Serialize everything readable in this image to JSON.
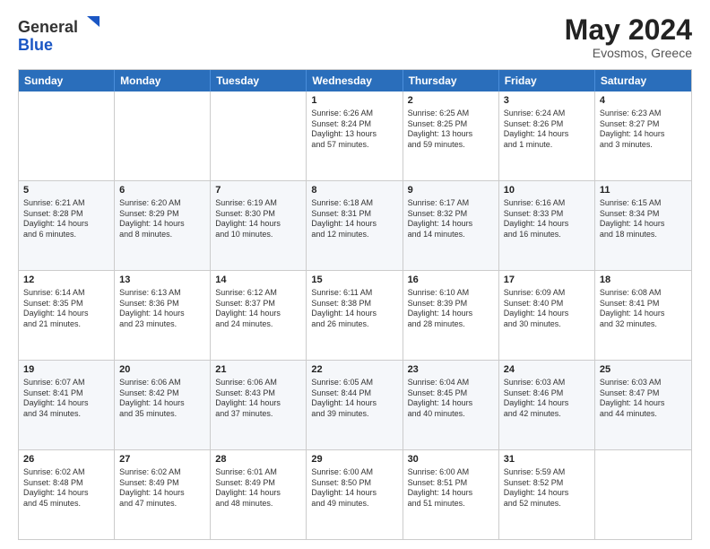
{
  "header": {
    "logo_line1": "General",
    "logo_line2": "Blue",
    "month": "May 2024",
    "location": "Evosmos, Greece"
  },
  "days": [
    "Sunday",
    "Monday",
    "Tuesday",
    "Wednesday",
    "Thursday",
    "Friday",
    "Saturday"
  ],
  "weeks": [
    [
      {
        "day": "",
        "info": ""
      },
      {
        "day": "",
        "info": ""
      },
      {
        "day": "",
        "info": ""
      },
      {
        "day": "1",
        "info": "Sunrise: 6:26 AM\nSunset: 8:24 PM\nDaylight: 13 hours\nand 57 minutes."
      },
      {
        "day": "2",
        "info": "Sunrise: 6:25 AM\nSunset: 8:25 PM\nDaylight: 13 hours\nand 59 minutes."
      },
      {
        "day": "3",
        "info": "Sunrise: 6:24 AM\nSunset: 8:26 PM\nDaylight: 14 hours\nand 1 minute."
      },
      {
        "day": "4",
        "info": "Sunrise: 6:23 AM\nSunset: 8:27 PM\nDaylight: 14 hours\nand 3 minutes."
      }
    ],
    [
      {
        "day": "5",
        "info": "Sunrise: 6:21 AM\nSunset: 8:28 PM\nDaylight: 14 hours\nand 6 minutes."
      },
      {
        "day": "6",
        "info": "Sunrise: 6:20 AM\nSunset: 8:29 PM\nDaylight: 14 hours\nand 8 minutes."
      },
      {
        "day": "7",
        "info": "Sunrise: 6:19 AM\nSunset: 8:30 PM\nDaylight: 14 hours\nand 10 minutes."
      },
      {
        "day": "8",
        "info": "Sunrise: 6:18 AM\nSunset: 8:31 PM\nDaylight: 14 hours\nand 12 minutes."
      },
      {
        "day": "9",
        "info": "Sunrise: 6:17 AM\nSunset: 8:32 PM\nDaylight: 14 hours\nand 14 minutes."
      },
      {
        "day": "10",
        "info": "Sunrise: 6:16 AM\nSunset: 8:33 PM\nDaylight: 14 hours\nand 16 minutes."
      },
      {
        "day": "11",
        "info": "Sunrise: 6:15 AM\nSunset: 8:34 PM\nDaylight: 14 hours\nand 18 minutes."
      }
    ],
    [
      {
        "day": "12",
        "info": "Sunrise: 6:14 AM\nSunset: 8:35 PM\nDaylight: 14 hours\nand 21 minutes."
      },
      {
        "day": "13",
        "info": "Sunrise: 6:13 AM\nSunset: 8:36 PM\nDaylight: 14 hours\nand 23 minutes."
      },
      {
        "day": "14",
        "info": "Sunrise: 6:12 AM\nSunset: 8:37 PM\nDaylight: 14 hours\nand 24 minutes."
      },
      {
        "day": "15",
        "info": "Sunrise: 6:11 AM\nSunset: 8:38 PM\nDaylight: 14 hours\nand 26 minutes."
      },
      {
        "day": "16",
        "info": "Sunrise: 6:10 AM\nSunset: 8:39 PM\nDaylight: 14 hours\nand 28 minutes."
      },
      {
        "day": "17",
        "info": "Sunrise: 6:09 AM\nSunset: 8:40 PM\nDaylight: 14 hours\nand 30 minutes."
      },
      {
        "day": "18",
        "info": "Sunrise: 6:08 AM\nSunset: 8:41 PM\nDaylight: 14 hours\nand 32 minutes."
      }
    ],
    [
      {
        "day": "19",
        "info": "Sunrise: 6:07 AM\nSunset: 8:41 PM\nDaylight: 14 hours\nand 34 minutes."
      },
      {
        "day": "20",
        "info": "Sunrise: 6:06 AM\nSunset: 8:42 PM\nDaylight: 14 hours\nand 35 minutes."
      },
      {
        "day": "21",
        "info": "Sunrise: 6:06 AM\nSunset: 8:43 PM\nDaylight: 14 hours\nand 37 minutes."
      },
      {
        "day": "22",
        "info": "Sunrise: 6:05 AM\nSunset: 8:44 PM\nDaylight: 14 hours\nand 39 minutes."
      },
      {
        "day": "23",
        "info": "Sunrise: 6:04 AM\nSunset: 8:45 PM\nDaylight: 14 hours\nand 40 minutes."
      },
      {
        "day": "24",
        "info": "Sunrise: 6:03 AM\nSunset: 8:46 PM\nDaylight: 14 hours\nand 42 minutes."
      },
      {
        "day": "25",
        "info": "Sunrise: 6:03 AM\nSunset: 8:47 PM\nDaylight: 14 hours\nand 44 minutes."
      }
    ],
    [
      {
        "day": "26",
        "info": "Sunrise: 6:02 AM\nSunset: 8:48 PM\nDaylight: 14 hours\nand 45 minutes."
      },
      {
        "day": "27",
        "info": "Sunrise: 6:02 AM\nSunset: 8:49 PM\nDaylight: 14 hours\nand 47 minutes."
      },
      {
        "day": "28",
        "info": "Sunrise: 6:01 AM\nSunset: 8:49 PM\nDaylight: 14 hours\nand 48 minutes."
      },
      {
        "day": "29",
        "info": "Sunrise: 6:00 AM\nSunset: 8:50 PM\nDaylight: 14 hours\nand 49 minutes."
      },
      {
        "day": "30",
        "info": "Sunrise: 6:00 AM\nSunset: 8:51 PM\nDaylight: 14 hours\nand 51 minutes."
      },
      {
        "day": "31",
        "info": "Sunrise: 5:59 AM\nSunset: 8:52 PM\nDaylight: 14 hours\nand 52 minutes."
      },
      {
        "day": "",
        "info": ""
      }
    ]
  ]
}
